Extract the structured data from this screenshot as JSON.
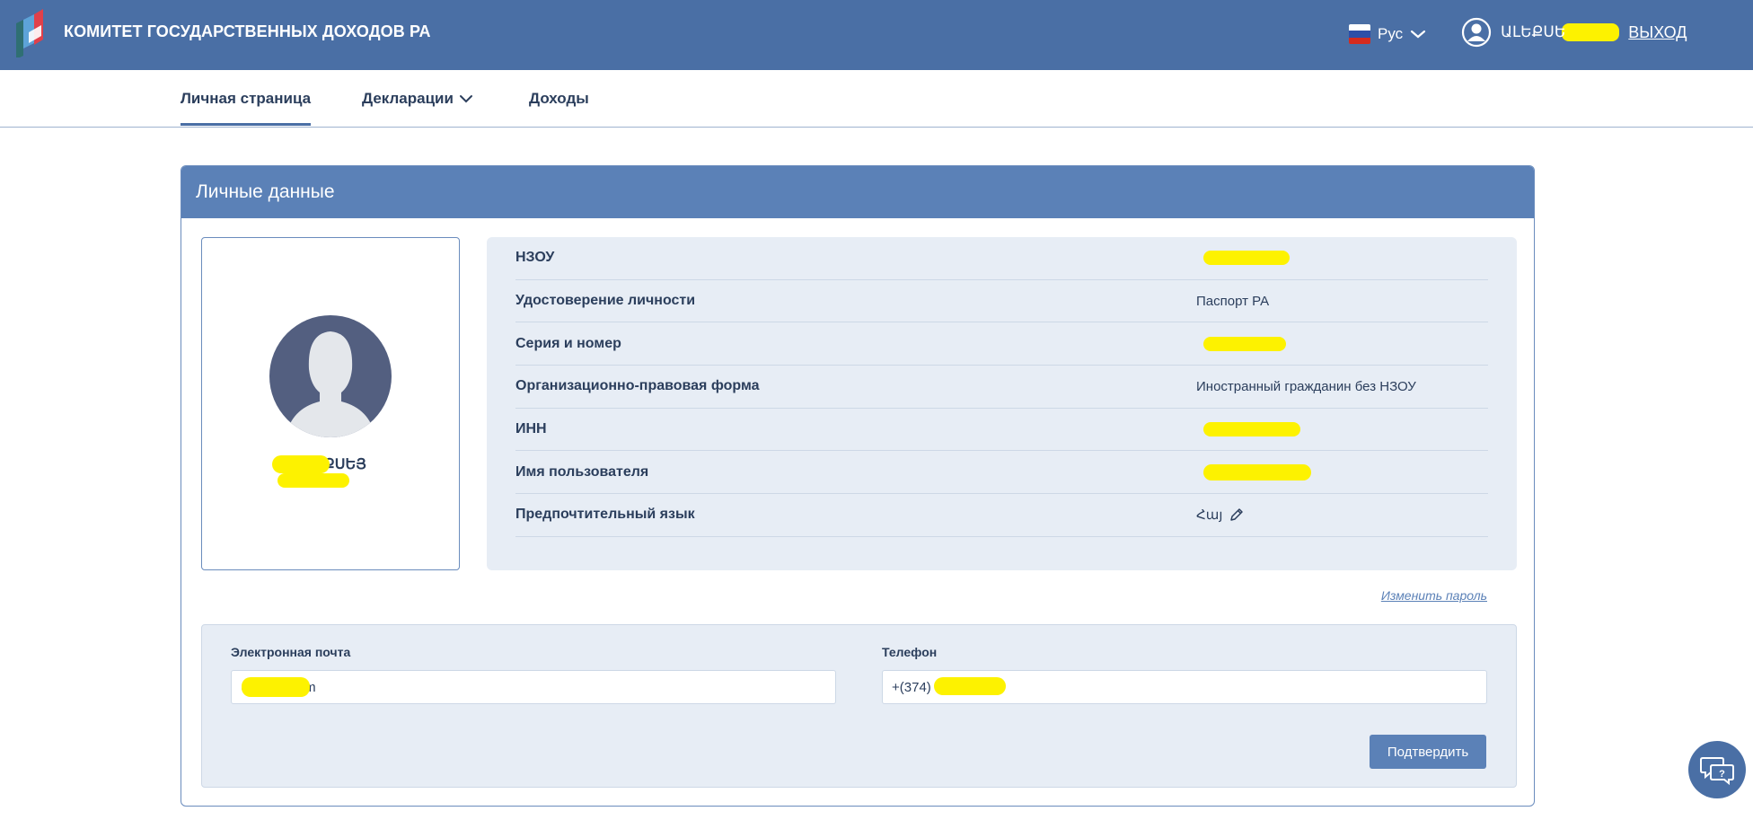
{
  "header": {
    "title": "КОМИТЕТ ГОСУДАРСТВЕННЫХ ДОХОДОВ РА",
    "language": "Рус",
    "user_name": "ԱԼԵՔՍԵ",
    "logout": "ВЫХОД",
    "icons": [
      "logo-icon",
      "russia-flag-icon",
      "chevron-down-icon",
      "user-circle-icon"
    ]
  },
  "nav": {
    "items": [
      {
        "label": "Личная страница",
        "active": true
      },
      {
        "label": "Декларации",
        "dropdown": true
      },
      {
        "label": "Доходы"
      }
    ]
  },
  "card": {
    "title": "Личные данные",
    "profile": {
      "name": "ԱԼԵՔՍԵՅ"
    },
    "info_rows": [
      {
        "label": "НЗОУ",
        "value": ""
      },
      {
        "label": "Удостоверение личности",
        "value": "Паспорт РА"
      },
      {
        "label": "Серия и номер",
        "value": ""
      },
      {
        "label": "Организационно-правовая форма",
        "value": "Иностранный гражданин без НЗОУ"
      },
      {
        "label": "ИНН",
        "value": ""
      },
      {
        "label": "Имя пользователя",
        "value": ""
      },
      {
        "label": "Предпочтительный язык",
        "value": "Հայ"
      }
    ],
    "change_password": "Изменить пароль",
    "email": {
      "label": "Электронная почта",
      "value": "@gmail.com"
    },
    "phone": {
      "label": "Телефон",
      "value": "+(374)"
    },
    "confirm_label": "Подтвердить"
  },
  "colors": {
    "header_bg": "#4a6fa5",
    "card_header_bg": "#5b81b7",
    "panel_bg": "#e7edf5",
    "redaction": "#fdf200"
  }
}
